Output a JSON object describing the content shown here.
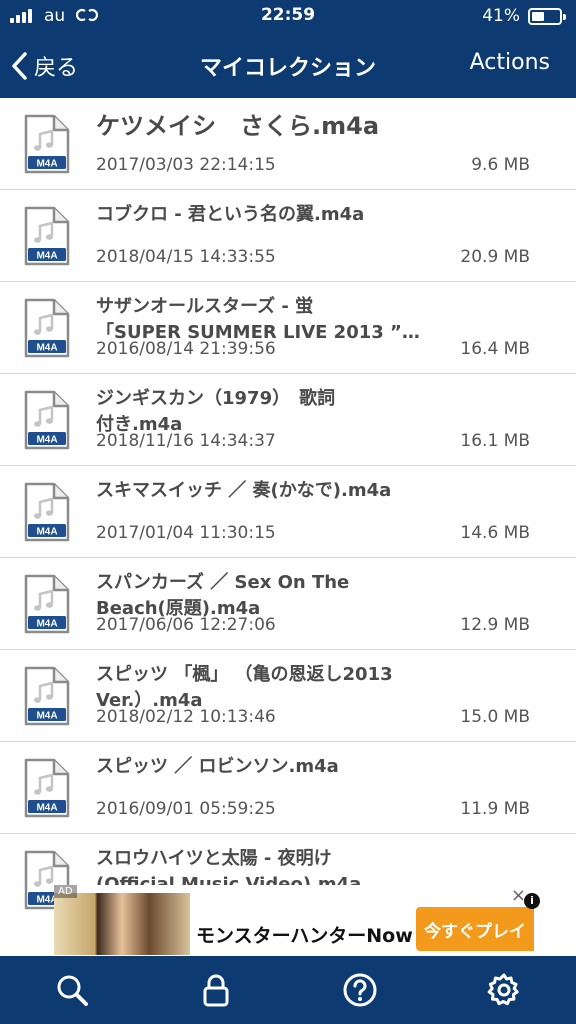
{
  "status": {
    "carrier": "au",
    "time": "22:59",
    "battery": "41%"
  },
  "nav": {
    "back_label": "戻る",
    "title": "マイコレクション",
    "actions_label": "Actions"
  },
  "file_badge": "M4A",
  "files": [
    {
      "name": "ケツメイシ　さくら.m4a",
      "date": "2017/03/03 22:14:15",
      "size": "9.6 MB"
    },
    {
      "name": "コブクロ - 君という名の翼.m4a",
      "date": "2018/04/15 14:33:55",
      "size": "20.9 MB"
    },
    {
      "name": "サザンオールスターズ - 蛍\n「SUPER SUMMER LIVE 2013 ”…",
      "date": "2016/08/14 21:39:56",
      "size": "16.4 MB"
    },
    {
      "name": "ジンギスカン（1979）　歌詞\n付き.m4a",
      "date": "2018/11/16 14:34:37",
      "size": "16.1 MB"
    },
    {
      "name": "スキマスイッチ ／ 奏(かなで).m4a",
      "date": "2017/01/04 11:30:15",
      "size": "14.6 MB"
    },
    {
      "name": "スパンカーズ ／ Sex On The\nBeach(原題).m4a",
      "date": "2017/06/06 12:27:06",
      "size": "12.9 MB"
    },
    {
      "name": "スピッツ 「楓」 （亀の恩返し2013\nVer.）.m4a",
      "date": "2018/02/12 10:13:46",
      "size": "15.0 MB"
    },
    {
      "name": "スピッツ ／ ロビンソン.m4a",
      "date": "2016/09/01 05:59:25",
      "size": "11.9 MB"
    },
    {
      "name": "スロウハイツと太陽 - 夜明け\n(Official Music Video).m4a",
      "date": "",
      "size": ""
    }
  ],
  "ad": {
    "tag": "AD",
    "text": "モンスターハンターNow",
    "cta": "今すぐプレイ",
    "close": "×",
    "info": "i"
  },
  "tabs": [
    {
      "name": "search",
      "icon": "search-icon"
    },
    {
      "name": "lock",
      "icon": "lock-icon"
    },
    {
      "name": "help",
      "icon": "help-icon"
    },
    {
      "name": "settings",
      "icon": "gear-icon"
    }
  ],
  "colors": {
    "bar": "#0d3a70",
    "cta": "#f39a1c",
    "badge": "#1f4f8f"
  }
}
